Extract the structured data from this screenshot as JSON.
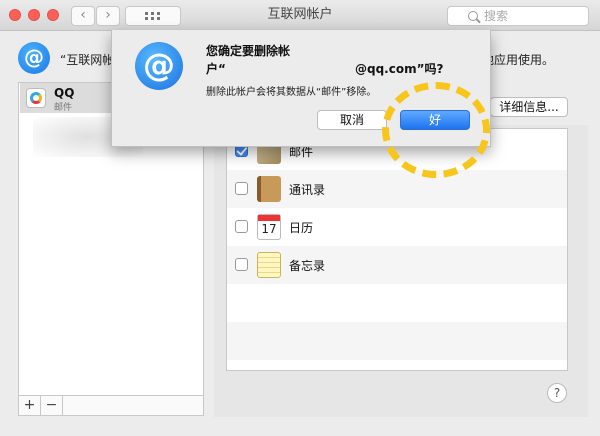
{
  "window": {
    "title": "互联网帐户",
    "search_placeholder": "搜索",
    "nav_back": "‹",
    "nav_forward": "›"
  },
  "colors": {
    "accent_blue": "#1d73ee",
    "highlight_circle": "#f7c51c",
    "close_red": "#ff5f57"
  },
  "description": {
    "left": "“互联网帐",
    "right": "他应用使用。"
  },
  "sidebar": {
    "account_name": "QQ",
    "account_sub": "邮件",
    "add_label": "+",
    "remove_label": "−"
  },
  "detail_button": "详细信息...",
  "apps": [
    {
      "name": "邮件",
      "checked": true,
      "icon": "mail-stamp-icon"
    },
    {
      "name": "通讯录",
      "checked": false,
      "icon": "contacts-book-icon"
    },
    {
      "name": "日历",
      "checked": false,
      "icon": "calendar-icon",
      "day": "17"
    },
    {
      "name": "备忘录",
      "checked": false,
      "icon": "notes-icon"
    }
  ],
  "help_label": "?",
  "dialog": {
    "icon_glyph": "@",
    "title_line1": "您确定要删除帐",
    "title_line2_start": "户“",
    "title_line2_end": "@qq.com”吗?",
    "message": "删除此帐户会将其数据从“邮件”移除。",
    "cancel_label": "取消",
    "ok_label": "好"
  }
}
